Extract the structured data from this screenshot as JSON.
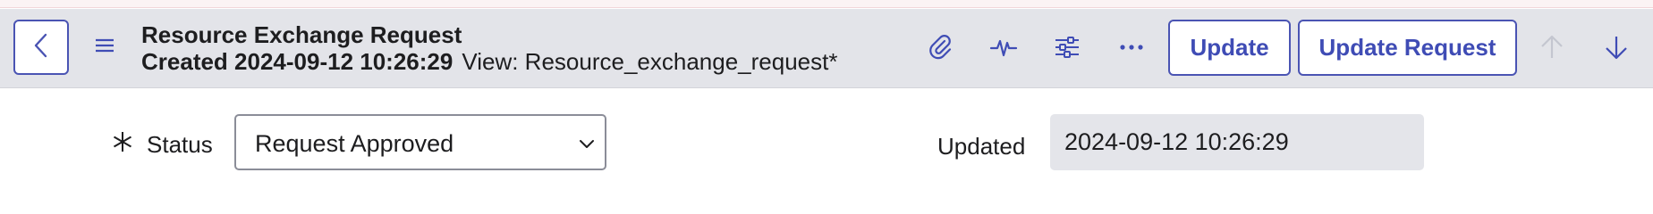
{
  "header": {
    "back_icon": "chevron-left-icon",
    "menu_icon": "hamburger-icon",
    "title": "Resource Exchange Request",
    "created": "Created 2024-09-12 10:26:29",
    "view": "View: Resource_exchange_request*",
    "toolbar_icons": [
      "paperclip-icon",
      "activity-icon",
      "sliders-icon",
      "more-icon"
    ],
    "update_label": "Update",
    "update_request_label": "Update Request",
    "nav_up_icon": "arrow-up-icon",
    "nav_down_icon": "arrow-down-icon"
  },
  "form": {
    "status_label": "Status",
    "status_value": "Request Approved",
    "updated_label": "Updated",
    "updated_value": "2024-09-12 10:26:29"
  },
  "colors": {
    "accent": "#3f4cb5",
    "header_bg": "#e3e4e9",
    "readonly_bg": "#e4e5ea",
    "disabled_icon": "#c4c6d0"
  }
}
